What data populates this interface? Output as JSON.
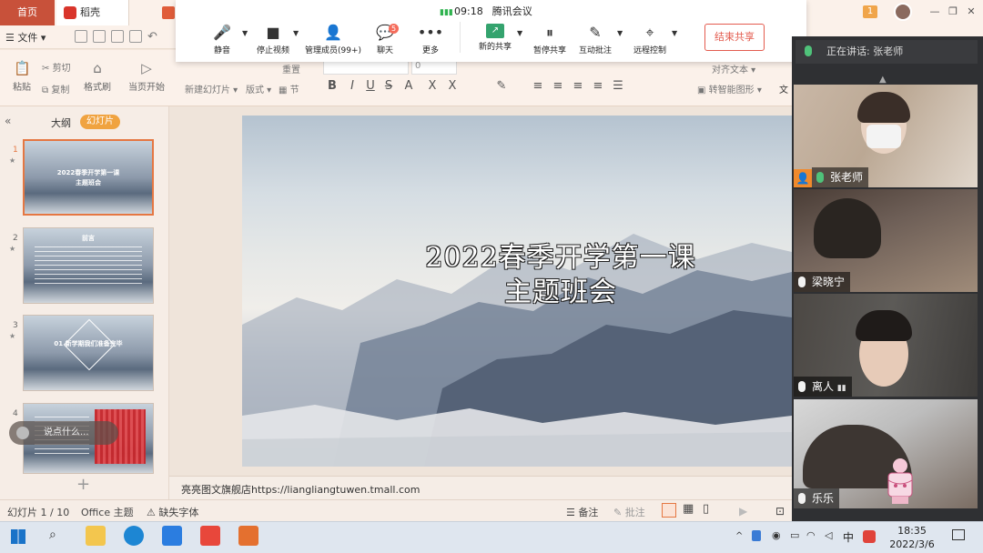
{
  "wps": {
    "tabs": {
      "home": "首页",
      "daoke": "稻壳"
    },
    "badge_count": "1",
    "menu": {
      "file": "文件"
    },
    "ribbon": {
      "paste": "粘贴",
      "cut": "剪切",
      "copy": "复制",
      "format_painter": "格式刷",
      "start_from_current": "当页开始",
      "new_slide": "新建幻灯片",
      "layout": "版式",
      "section": "节",
      "reset": "重置",
      "font_size_value": "0",
      "text_box": "文",
      "to_smartart": "转智能图形",
      "align_text": "对齐文本"
    }
  },
  "meeting": {
    "time": "09:18",
    "app_name": "腾讯会议",
    "buttons": {
      "mute": "静音",
      "stop_video": "停止视频",
      "manage_members": "管理成员(99+)",
      "chat": "聊天",
      "more": "更多",
      "new_share": "新的共享",
      "pause_share": "暂停共享",
      "annotate": "互动批注",
      "remote_control": "远程控制",
      "end_share": "结束共享"
    },
    "chat_badge": "5",
    "speaking_label": "正在讲话: 张老师",
    "participants": [
      {
        "name": "张老师"
      },
      {
        "name": "梁晓宁"
      },
      {
        "name": "离人"
      },
      {
        "name": "乐乐"
      }
    ]
  },
  "slides_pane": {
    "tab_outline": "大纲",
    "tab_slides": "幻灯片",
    "thumbs": [
      {
        "num": "1",
        "title": "2022春季开学第一课 主题班会"
      },
      {
        "num": "2",
        "title": "前言"
      },
      {
        "num": "3",
        "title": "01 新学期我们准备完毕"
      },
      {
        "num": "4",
        "title": ""
      }
    ],
    "say_something": "说点什么..."
  },
  "slide": {
    "title_line1": "2022春季开学第一课",
    "title_line2": "主题班会"
  },
  "notes_text": "亮亮图文旗舰店https://liangliangtuwen.tmall.com",
  "status": {
    "slide_index": "幻灯片 1 / 10",
    "theme": "Office 主题",
    "missing_fonts": "缺失字体",
    "notes": "备注",
    "comments": "批注"
  },
  "taskbar": {
    "time": "18:35",
    "date": "2022/3/6",
    "ime": "中"
  }
}
